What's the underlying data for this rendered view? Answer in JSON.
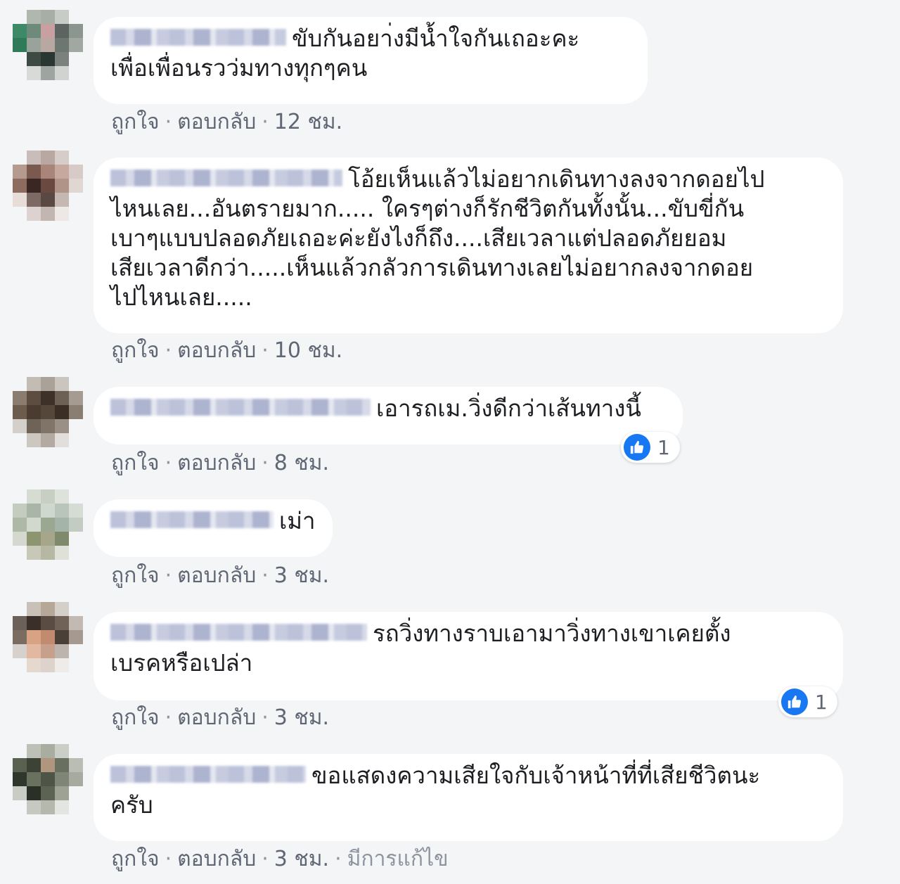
{
  "actions": {
    "like": "ถูกใจ",
    "reply": "ตอบกลับ",
    "separator": "·"
  },
  "accent_color": "#1877f2",
  "comments": [
    {
      "text_line1": "ขับกันอยา่งมีน้ำใจกันเถอะคะ",
      "text_rest": "เพื่อเพื่อนรวว่มทางทุกๆคน",
      "time": "12 ชม."
    },
    {
      "text_line1": "โอ้ยเห็นแล้วไม่อยากเดินทางลงจากดอยไป",
      "text_rest": "ไหนเลย...อันตรายมาก..... ใครๆต่างก็รักชีวิตกันทั้งนั้น...ขับขี่กัน\nเบาๆแบบปลอดภัยเถอะค่ะยังไงก็ถึง....เสียเวลาแต่ปลอดภัยยอม\nเสียเวลาดีกว่า.....เห็นแล้วกลัวการเดินทางเลยไม่อยากลงจากดอย\nไปไหนเลย.....",
      "time": "10 ชม."
    },
    {
      "text_line1": "เอารถเม.วิ่งดีกว่าเส้นทางนี้",
      "text_rest": "",
      "time": "8 ชม.",
      "reaction": {
        "icon": "like-icon",
        "count": "1"
      }
    },
    {
      "text_line1": "เม่า",
      "text_rest": "",
      "time": "3 ชม."
    },
    {
      "text_line1": "รถวิ่งทางราบเอามาวิ่งทางเขาเคยตั้ง",
      "text_rest": "เบรคหรือเปล่า",
      "time": "3 ชม.",
      "reaction": {
        "icon": "like-icon",
        "count": "1"
      }
    },
    {
      "text_line1": "ขอแสดงความเสียใจกับเจ้าหน้าที่ที่เสียชีวิตนะ",
      "text_rest": "ครับ",
      "time": "3 ชม.",
      "edited": "มีการแก้ไข"
    }
  ]
}
